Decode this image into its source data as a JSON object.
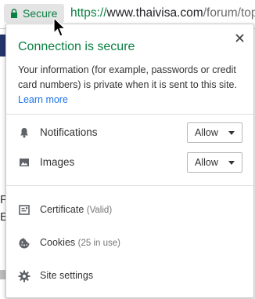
{
  "address_bar": {
    "secure_label": "Secure",
    "url_scheme": "https://",
    "url_host": "www.thaivisa.com",
    "url_path": "/forum/topic"
  },
  "bubble": {
    "title": "Connection is secure",
    "description": "Your information (for example, passwords or credit card numbers) is private when it is sent to this site.",
    "learn_more": "Learn more",
    "permissions": [
      {
        "label": "Notifications",
        "value": "Allow",
        "icon": "bell-icon"
      },
      {
        "label": "Images",
        "value": "Allow",
        "icon": "image-icon"
      }
    ],
    "links": [
      {
        "label": "Certificate",
        "detail": "(Valid)",
        "icon": "certificate-icon"
      },
      {
        "label": "Cookies",
        "detail": "(25 in use)",
        "icon": "cookie-icon"
      },
      {
        "label": "Site settings",
        "detail": "",
        "icon": "gear-icon"
      }
    ]
  },
  "background_page": {
    "line1": "F",
    "line2": "E"
  },
  "colors": {
    "secure_green": "#0b8043",
    "link_blue": "#1a73e8"
  }
}
